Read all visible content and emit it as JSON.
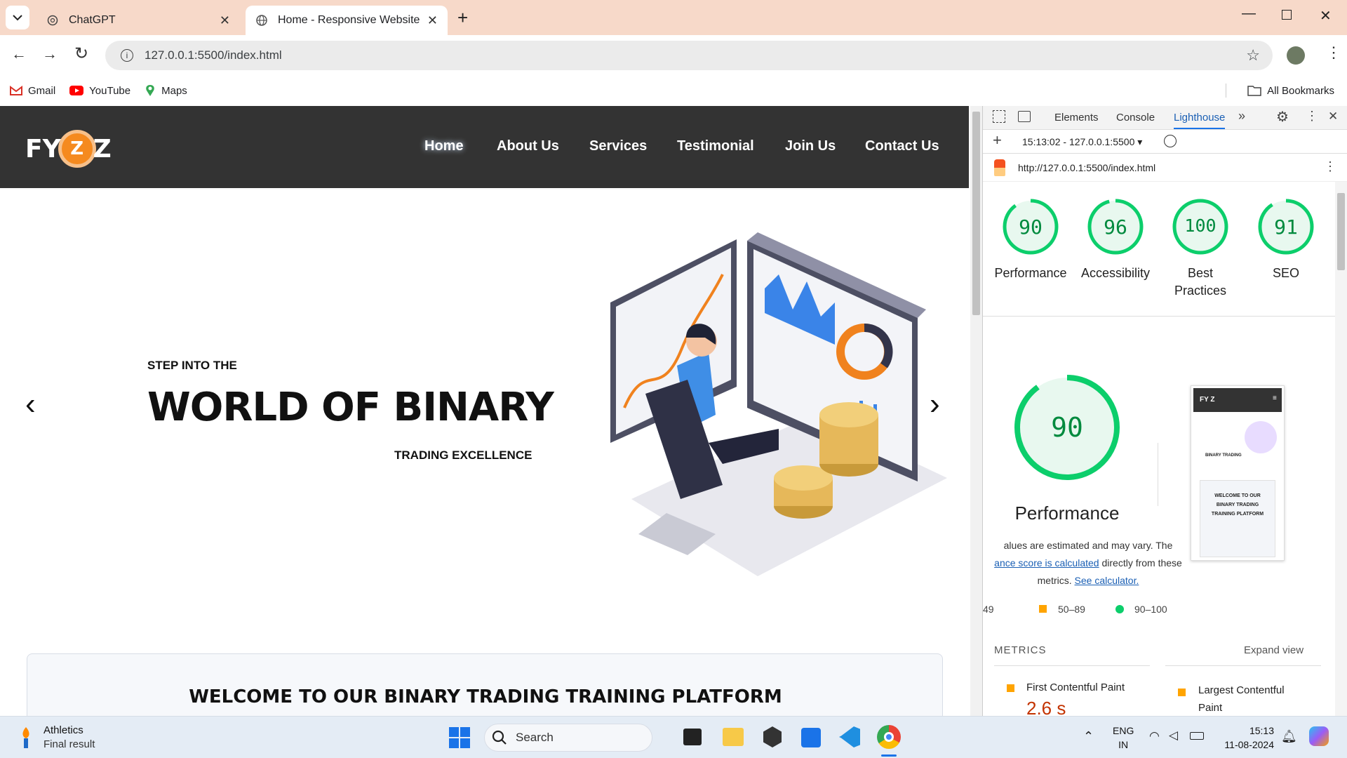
{
  "browser": {
    "tabs": [
      {
        "title": "ChatGPT"
      },
      {
        "title": "Home - Responsive Website"
      }
    ],
    "url": "127.0.0.1:5500/index.html",
    "bookmarks": [
      "Gmail",
      "YouTube",
      "Maps"
    ],
    "all_bookmarks": "All Bookmarks"
  },
  "site": {
    "logo": {
      "left": "FY",
      "mid": "Z",
      "right": "Z"
    },
    "nav": [
      "Home",
      "About Us",
      "Services",
      "Testimonial",
      "Join Us",
      "Contact Us"
    ],
    "active_nav": "Home",
    "hero": {
      "kicker": "STEP INTO THE",
      "headline": "WORLD OF BINARY",
      "sub": "TRADING EXCELLENCE",
      "prev": "‹",
      "next": "›"
    },
    "welcome": "WELCOME TO OUR BINARY TRADING TRAINING PLATFORM"
  },
  "devtools": {
    "tabs": [
      "Elements",
      "Console",
      "Lighthouse"
    ],
    "active_tab": "Lighthouse",
    "report_select": "15:13:02 - 127.0.0.1:5500",
    "report_url": "http://127.0.0.1:5500/index.html",
    "scores": [
      {
        "label": "Performance",
        "value": 90
      },
      {
        "label": "Accessibility",
        "value": 96
      },
      {
        "label": "Best Practices",
        "value": 100
      },
      {
        "label": "SEO",
        "value": 91
      }
    ],
    "main_score": {
      "label": "Performance",
      "value": 90
    },
    "note_line1": "alues are estimated and may vary. The",
    "note_link1": "ance score is calculated",
    "note_line2_rest": " directly from these",
    "note_line3": "metrics.",
    "note_link2": "See calculator.",
    "legend": [
      "49",
      "50–89",
      "90–100"
    ],
    "metrics_title": "METRICS",
    "expand": "Expand view",
    "metrics": [
      {
        "name": "First Contentful Paint",
        "value": "2.6 s"
      },
      {
        "name": "Largest Contentful Paint",
        "value": ""
      }
    ],
    "thumb": {
      "logo": "FY Z",
      "hero_line": "BINARY TRADING",
      "welcome": "WELCOME TO OUR BINARY TRADING TRAINING PLATFORM"
    },
    "score_color": "#0cce6b"
  },
  "taskbar": {
    "weather_title": "Athletics",
    "weather_sub": "Final result",
    "search": "Search",
    "lang1": "ENG",
    "lang2": "IN",
    "time": "15:13",
    "date": "11-08-2024"
  }
}
